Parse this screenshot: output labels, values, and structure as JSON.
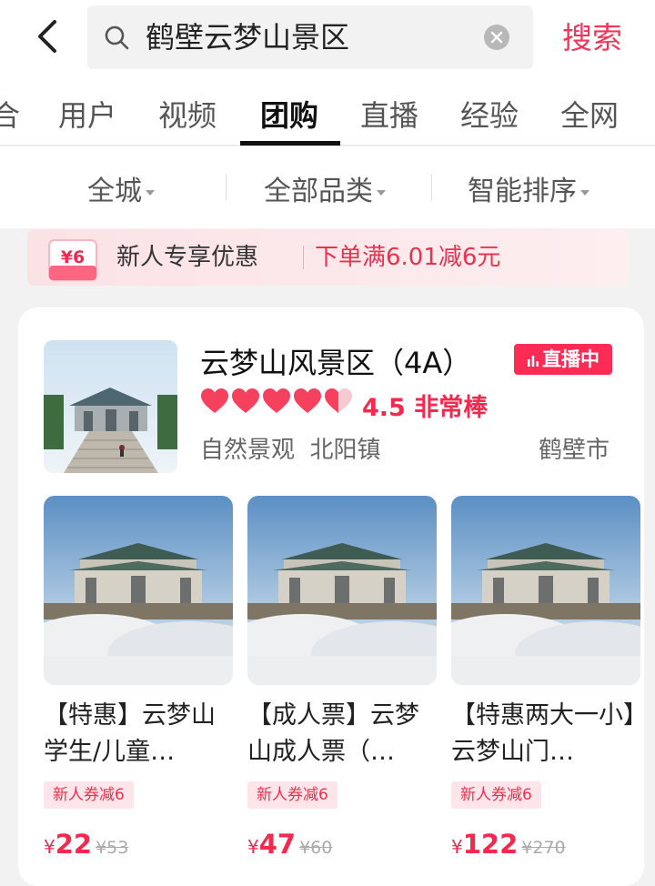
{
  "search": {
    "query": "鹤壁云梦山景区",
    "button_label": "搜索"
  },
  "tabs": [
    {
      "label": "合"
    },
    {
      "label": "用户"
    },
    {
      "label": "视频"
    },
    {
      "label": "团购",
      "active": true
    },
    {
      "label": "直播"
    },
    {
      "label": "经验"
    },
    {
      "label": "全网"
    }
  ],
  "filters": [
    {
      "label": "全城"
    },
    {
      "label": "全部品类"
    },
    {
      "label": "智能排序"
    }
  ],
  "banner": {
    "coupon_amount": "¥6",
    "text": "新人专享优惠",
    "offer": "下单满6.01减6元"
  },
  "shop": {
    "name": "云梦山风景区（4A）",
    "live_badge": "直播中",
    "rating_value": 4.5,
    "rating_text": "4.5 非常棒",
    "category": "自然景观",
    "area": "北阳镇",
    "city": "鹤壁市"
  },
  "deals": [
    {
      "title": "【特惠】云梦山学生/儿童…",
      "tag": "新人券减6",
      "currency": "¥",
      "price": "22",
      "original_price": "¥53"
    },
    {
      "title": "【成人票】云梦山成人票（…",
      "tag": "新人券减6",
      "currency": "¥",
      "price": "47",
      "original_price": "¥60"
    },
    {
      "title": "【特惠两大一小】云梦山门…",
      "tag": "新人券减6",
      "currency": "¥",
      "price": "122",
      "original_price": "¥270"
    }
  ],
  "colors": {
    "accent": "#fe2c55",
    "price": "#f5284f",
    "search_button": "#f2365a"
  },
  "icons": [
    "back-arrow-icon",
    "search-icon",
    "clear-icon",
    "coupon-icon",
    "heart-icon",
    "live-bars-icon"
  ]
}
